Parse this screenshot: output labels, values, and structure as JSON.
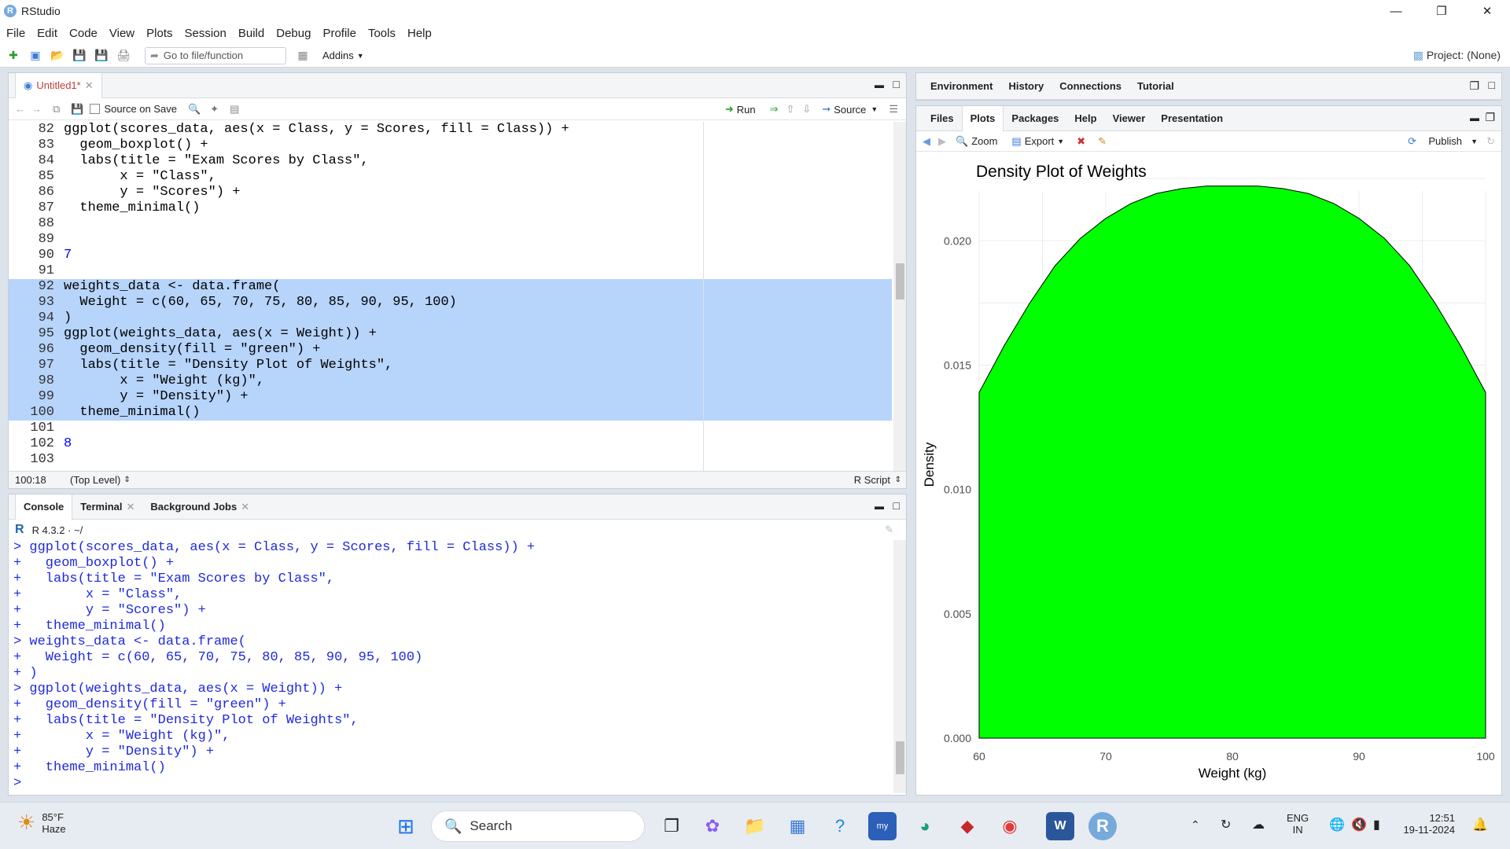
{
  "window": {
    "title": "RStudio",
    "logo": "R"
  },
  "menu": [
    "File",
    "Edit",
    "Code",
    "View",
    "Plots",
    "Session",
    "Build",
    "Debug",
    "Profile",
    "Tools",
    "Help"
  ],
  "toolbar": {
    "goto_placeholder": "Go to file/function",
    "addins": "Addins",
    "project": "Project: (None)"
  },
  "editor": {
    "tab_label": "Untitled1*",
    "source_on_save": "Source on Save",
    "run": "Run",
    "source": "Source",
    "status_pos": "100:18",
    "status_scope": "(Top Level)",
    "status_type": "R Script",
    "lines": [
      {
        "n": "82",
        "t": "ggplot(scores_data, aes(x = Class, y = Scores, fill = Class)) +",
        "sel": false
      },
      {
        "n": "83",
        "t": "  geom_boxplot() +",
        "sel": false
      },
      {
        "n": "84",
        "t": "  labs(title = \"Exam Scores by Class\",",
        "sel": false
      },
      {
        "n": "85",
        "t": "       x = \"Class\",",
        "sel": false
      },
      {
        "n": "86",
        "t": "       y = \"Scores\") +",
        "sel": false
      },
      {
        "n": "87",
        "t": "  theme_minimal()",
        "sel": false
      },
      {
        "n": "88",
        "t": "",
        "sel": false
      },
      {
        "n": "89",
        "t": "",
        "sel": false
      },
      {
        "n": "90",
        "t": "7",
        "sel": false
      },
      {
        "n": "91",
        "t": "",
        "sel": false
      },
      {
        "n": "92",
        "t": "weights_data <- data.frame(",
        "sel": true
      },
      {
        "n": "93",
        "t": "  Weight = c(60, 65, 70, 75, 80, 85, 90, 95, 100)",
        "sel": true
      },
      {
        "n": "94",
        "t": ")",
        "sel": true
      },
      {
        "n": "95",
        "t": "ggplot(weights_data, aes(x = Weight)) +",
        "sel": true
      },
      {
        "n": "96",
        "t": "  geom_density(fill = \"green\") +",
        "sel": true
      },
      {
        "n": "97",
        "t": "  labs(title = \"Density Plot of Weights\",",
        "sel": true
      },
      {
        "n": "98",
        "t": "       x = \"Weight (kg)\",",
        "sel": true
      },
      {
        "n": "99",
        "t": "       y = \"Density\") +",
        "sel": true
      },
      {
        "n": "100",
        "t": "  theme_minimal()",
        "sel": true
      },
      {
        "n": "101",
        "t": "",
        "sel": false
      },
      {
        "n": "102",
        "t": "8",
        "sel": false
      },
      {
        "n": "103",
        "t": "",
        "sel": false
      }
    ]
  },
  "console": {
    "tabs": [
      "Console",
      "Terminal",
      "Background Jobs"
    ],
    "version": "R 4.3.2 · ~/",
    "lines": [
      "> ggplot(scores_data, aes(x = Class, y = Scores, fill = Class)) +",
      "+   geom_boxplot() +",
      "+   labs(title = \"Exam Scores by Class\",",
      "+        x = \"Class\",",
      "+        y = \"Scores\") +",
      "+   theme_minimal()",
      "> weights_data <- data.frame(",
      "+   Weight = c(60, 65, 70, 75, 80, 85, 90, 95, 100)",
      "+ )",
      "> ggplot(weights_data, aes(x = Weight)) +",
      "+   geom_density(fill = \"green\") +",
      "+   labs(title = \"Density Plot of Weights\",",
      "+        x = \"Weight (kg)\",",
      "+        y = \"Density\") +",
      "+   theme_minimal()",
      "> "
    ]
  },
  "env_tabs": [
    "Environment",
    "History",
    "Connections",
    "Tutorial"
  ],
  "files_tabs": [
    "Files",
    "Plots",
    "Packages",
    "Help",
    "Viewer",
    "Presentation"
  ],
  "plot_toolbar": {
    "zoom": "Zoom",
    "export": "Export",
    "publish": "Publish"
  },
  "chart_data": {
    "type": "area",
    "title": "Density Plot of Weights",
    "xlabel": "Weight (kg)",
    "ylabel": "Density",
    "fill": "#00ff00",
    "xlim": [
      60,
      100
    ],
    "ylim": [
      0,
      0.022
    ],
    "xticks": [
      "60",
      "70",
      "80",
      "90",
      "100"
    ],
    "yticks": [
      "0.000",
      "0.005",
      "0.010",
      "0.015",
      "0.020"
    ],
    "x": [
      60,
      62,
      64,
      66,
      68,
      70,
      72,
      74,
      76,
      78,
      80,
      82,
      84,
      86,
      88,
      90,
      92,
      94,
      96,
      98,
      100
    ],
    "y": [
      0.0139,
      0.0158,
      0.0175,
      0.019,
      0.0201,
      0.0209,
      0.0215,
      0.0219,
      0.0221,
      0.0222,
      0.0222,
      0.0222,
      0.0221,
      0.0219,
      0.0215,
      0.0209,
      0.0201,
      0.019,
      0.0175,
      0.0158,
      0.0139
    ]
  },
  "taskbar": {
    "weather_temp": "85°F",
    "weather_desc": "Haze",
    "search": "Search",
    "lang": "ENG",
    "region": "IN",
    "time": "12:51",
    "date": "19-11-2024"
  }
}
